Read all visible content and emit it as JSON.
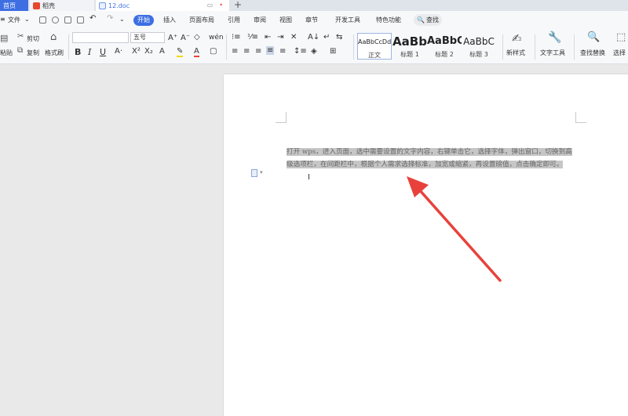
{
  "tabs": {
    "home": "首页",
    "daoke": "稻壳",
    "doc": "12.doc",
    "new_tab": "+"
  },
  "menu": {
    "file": "文件",
    "items": [
      "开始",
      "插入",
      "页面布局",
      "引用",
      "审阅",
      "视图",
      "章节",
      "开发工具",
      "特色功能"
    ],
    "search": "查找"
  },
  "ribbon": {
    "cut": "剪切",
    "paste": "粘贴",
    "copy": "复制",
    "format_painter": "格式刷",
    "font_size": "五号",
    "styles": [
      {
        "sample": "AaBbCcDd",
        "name": "正文"
      },
      {
        "sample": "AaBb",
        "name": "标题 1"
      },
      {
        "sample": "AaBbC",
        "name": "标题 2"
      },
      {
        "sample": "AaBbC",
        "name": "标题 3"
      }
    ],
    "new_style": "新样式",
    "text_tools": "文字工具",
    "find_replace": "查找替换",
    "select": "选择"
  },
  "document": {
    "text": "打开 wps，进入页面，选中需要设置的文字内容，右键单击它，选择字体，弹出窗口，切换到高级选项栏，在间距栏中，根据个人需求选择标准，加宽或缩紧，再设置磅值，点击确定即可。"
  },
  "colors": {
    "accent": "#3d6fe3",
    "arrow": "#e8413b",
    "highlight": "#c6c6c6"
  }
}
